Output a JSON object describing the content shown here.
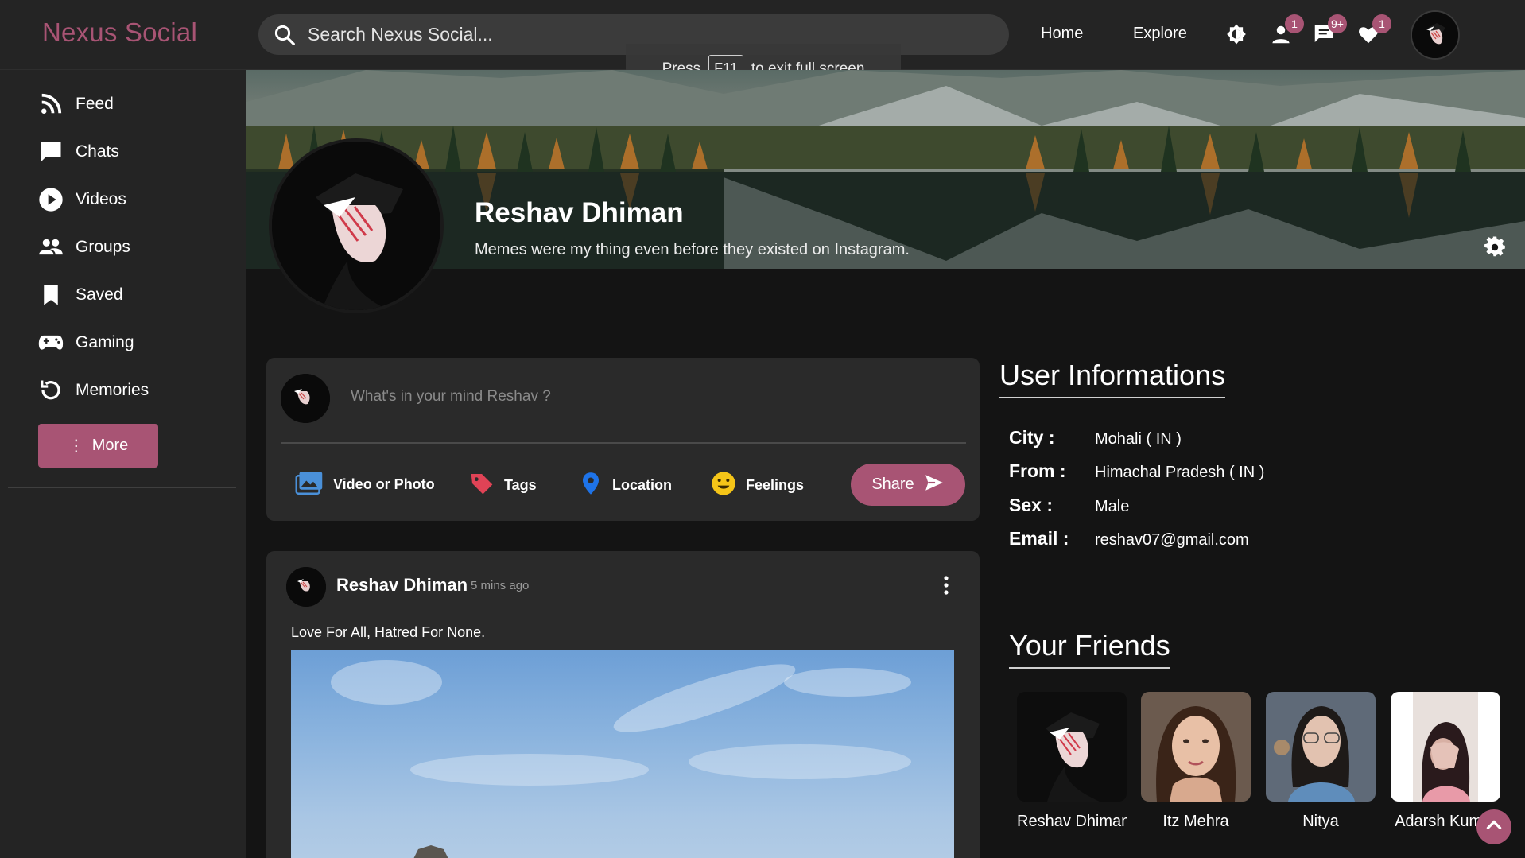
{
  "app": {
    "brand": "Nexus Social",
    "accent_color": "#a85474"
  },
  "topbar": {
    "search_placeholder": "Search Nexus Social...",
    "nav": [
      "Home",
      "Explore"
    ],
    "icons": [
      {
        "name": "theme-toggle-icon",
        "badge": ""
      },
      {
        "name": "friend-requests-icon",
        "badge": "1"
      },
      {
        "name": "messages-icon",
        "badge": "9+"
      },
      {
        "name": "notifications-heart-icon",
        "badge": "1"
      }
    ]
  },
  "toast": {
    "before": "Press",
    "key": "F11",
    "after": "to exit full screen"
  },
  "sidebar": {
    "items": [
      {
        "label": "Feed",
        "icon": "rss-icon"
      },
      {
        "label": "Chats",
        "icon": "chat-icon"
      },
      {
        "label": "Videos",
        "icon": "play-circle-icon"
      },
      {
        "label": "Groups",
        "icon": "groups-icon"
      },
      {
        "label": "Saved",
        "icon": "bookmark-icon"
      },
      {
        "label": "Gaming",
        "icon": "gamepad-icon"
      },
      {
        "label": "Memories",
        "icon": "history-icon"
      }
    ],
    "more_label": "More"
  },
  "profile": {
    "name": "Reshav Dhiman",
    "bio": "Memes were my thing even before they existed on Instagram."
  },
  "composer": {
    "placeholder": "What's in your mind Reshav ?",
    "actions": [
      {
        "label": "Video or Photo",
        "icon": "photo-icon"
      },
      {
        "label": "Tags",
        "icon": "tag-icon"
      },
      {
        "label": "Location",
        "icon": "location-pin-icon"
      },
      {
        "label": "Feelings",
        "icon": "smiley-icon"
      }
    ],
    "share_label": "Share"
  },
  "post": {
    "author": "Reshav Dhiman",
    "time": "5 mins ago",
    "text": "Love For All, Hatred For None."
  },
  "user_info": {
    "title": "User Informations",
    "rows": [
      {
        "key": "City :",
        "value": "Mohali ( IN )"
      },
      {
        "key": "From :",
        "value": "Himachal Pradesh ( IN )"
      },
      {
        "key": "Sex :",
        "value": "Male"
      },
      {
        "key": "Email :",
        "value": "reshav07@gmail.com"
      }
    ]
  },
  "friends": {
    "title": "Your Friends",
    "list": [
      {
        "name": "Reshav Dhiman"
      },
      {
        "name": "Itz Mehra"
      },
      {
        "name": "Nitya"
      },
      {
        "name": "Adarsh Kumar"
      }
    ]
  }
}
